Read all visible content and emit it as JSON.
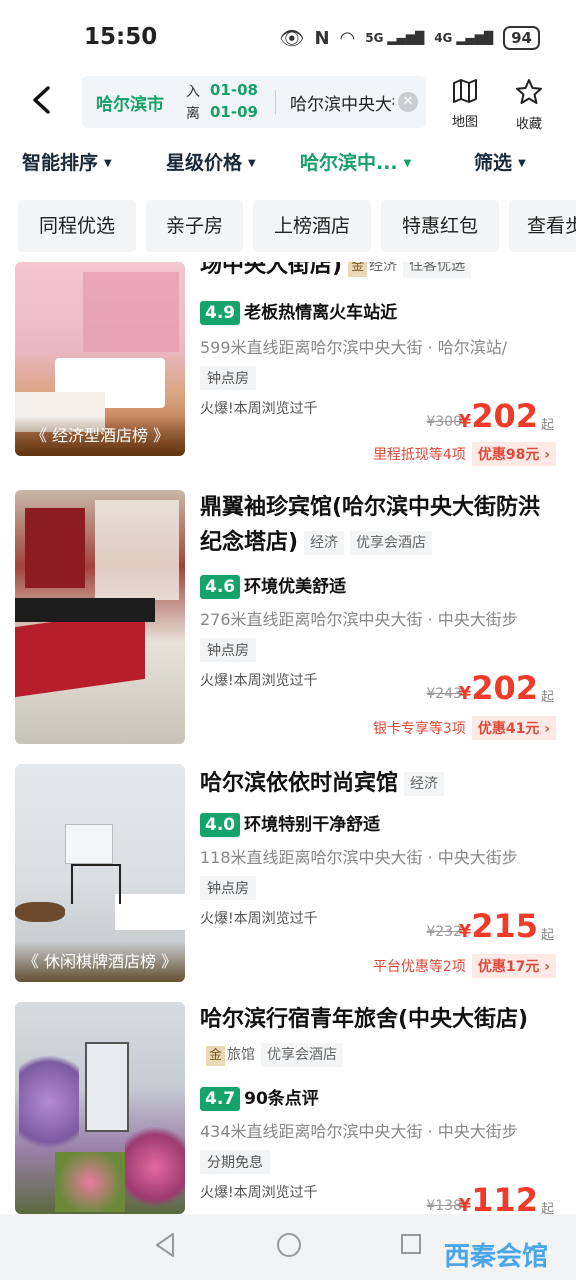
{
  "status": {
    "time": "15:50",
    "battery": "94",
    "net1": "5G",
    "net2": "4G"
  },
  "search": {
    "city": "哈尔滨市",
    "checkin_label": "入",
    "checkin": "01-08",
    "checkout_label": "离",
    "checkout": "01-09",
    "keyword": "哈尔滨中央大街",
    "map_label": "地图",
    "fav_label": "收藏"
  },
  "sort": {
    "items": [
      "智能排序",
      "星级价格",
      "哈尔滨中...",
      "筛选"
    ]
  },
  "chips": [
    "同程优选",
    "亲子房",
    "上榜酒店",
    "特惠红包",
    "查看步"
  ],
  "hotels": [
    {
      "name": "场中央大街店)",
      "gold": "金",
      "tags": [
        "经济",
        "住客优选"
      ],
      "score": "4.9",
      "comment": "老板热情离火车站近",
      "distance": "599米直线距离哈尔滨中央大街 · 哈尔滨站/",
      "room_tag": "钟点房",
      "hot": "火爆!本周浏览过千",
      "orig_price": "¥300",
      "price": "202",
      "yen": "¥",
      "qi": "起",
      "promo_left": "里程抵现等4项",
      "promo_right": "优惠98元",
      "banner": "《 经济型酒店榜 》"
    },
    {
      "name": "鼎翼袖珍宾馆(哈尔滨中央大街防洪纪念塔店)",
      "tags": [
        "经济",
        "优享会酒店"
      ],
      "score": "4.6",
      "comment": "环境优美舒适",
      "distance": "276米直线距离哈尔滨中央大街 · 中央大街步",
      "room_tag": "钟点房",
      "hot": "火爆!本周浏览过千",
      "orig_price": "¥243",
      "price": "202",
      "yen": "¥",
      "qi": "起",
      "promo_left": "银卡专享等3项",
      "promo_right": "优惠41元"
    },
    {
      "name": "哈尔滨依依时尚宾馆",
      "tags": [
        "经济"
      ],
      "score": "4.0",
      "comment": "环境特别干净舒适",
      "distance": "118米直线距离哈尔滨中央大街 · 中央大街步",
      "room_tag": "钟点房",
      "hot": "火爆!本周浏览过千",
      "orig_price": "¥232",
      "price": "215",
      "yen": "¥",
      "qi": "起",
      "promo_left": "平台优惠等2项",
      "promo_right": "优惠17元",
      "banner": "《 休闲棋牌酒店榜 》"
    },
    {
      "name": "哈尔滨行宿青年旅舍(中央大街店)",
      "gold": "金",
      "tags": [
        "旅馆",
        "优享会酒店"
      ],
      "score": "4.7",
      "comment": "90条点评",
      "distance": "434米直线距离哈尔滨中央大街 · 中央大街步",
      "room_tag": "分期免息",
      "hot": "火爆!本周浏览过千",
      "orig_price": "¥138",
      "price": "112",
      "yen": "¥",
      "qi": "起"
    }
  ],
  "watermark": "西秦会馆"
}
